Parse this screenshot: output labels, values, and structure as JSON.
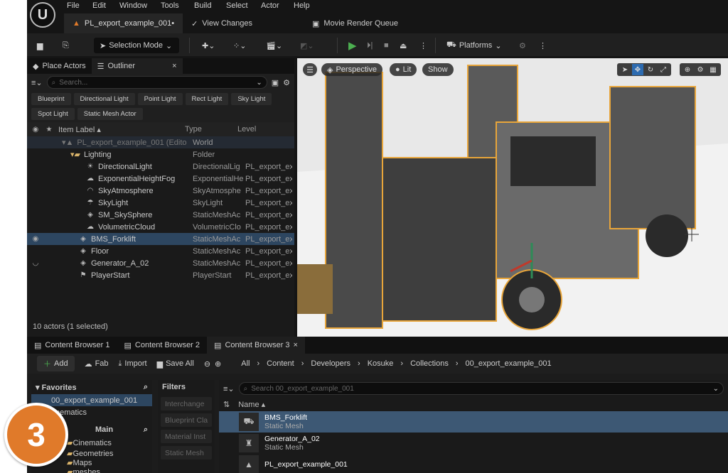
{
  "menu": [
    "File",
    "Edit",
    "Window",
    "Tools",
    "Build",
    "Select",
    "Actor",
    "Help"
  ],
  "tabs": {
    "doc": "PL_export_example_001•",
    "view_changes": "View Changes",
    "movie_render": "Movie Render Queue"
  },
  "toolbar": {
    "selection_mode": "Selection Mode",
    "platforms": "Platforms"
  },
  "left_tabs": {
    "place_actors": "Place Actors",
    "outliner": "Outliner"
  },
  "search": {
    "placeholder": "Search..."
  },
  "chips": [
    "Blueprint",
    "Directional Light",
    "Point Light",
    "Rect Light",
    "Sky Light",
    "Spot Light",
    "Static Mesh Actor"
  ],
  "columns": {
    "label": "Item Label ▴",
    "type": "Type",
    "level": "Level"
  },
  "world_row": {
    "label": "PL_export_example_001 (Edito",
    "type": "World"
  },
  "folder_row": {
    "label": "Lighting",
    "type": "Folder"
  },
  "rows": [
    {
      "label": "DirectionalLight",
      "type": "DirectionalLig",
      "level": "PL_export_exa",
      "icon": "directional-light-icon"
    },
    {
      "label": "ExponentialHeightFog",
      "type": "ExponentialHe",
      "level": "PL_export_exa",
      "icon": "fog-icon"
    },
    {
      "label": "SkyAtmosphere",
      "type": "SkyAtmosphe",
      "level": "PL_export_exa",
      "icon": "sky-atmosphere-icon"
    },
    {
      "label": "SkyLight",
      "type": "SkyLight",
      "level": "PL_export_exa",
      "icon": "skylight-icon"
    },
    {
      "label": "SM_SkySphere",
      "type": "StaticMeshAc",
      "level": "PL_export_exa",
      "icon": "static-mesh-icon"
    },
    {
      "label": "VolumetricCloud",
      "type": "VolumetricClo",
      "level": "PL_export_exa",
      "icon": "cloud-icon"
    },
    {
      "label": "BMS_Forklift",
      "type": "StaticMeshAc",
      "level": "PL_export_exa",
      "icon": "static-mesh-icon"
    },
    {
      "label": "Floor",
      "type": "StaticMeshAc",
      "level": "PL_export_exa",
      "icon": "static-mesh-icon"
    },
    {
      "label": "Generator_A_02",
      "type": "StaticMeshAc",
      "level": "PL_export_exa",
      "icon": "static-mesh-icon"
    },
    {
      "label": "PlayerStart",
      "type": "PlayerStart",
      "level": "PL_export_exa",
      "icon": "player-start-icon"
    }
  ],
  "status": "10 actors (1 selected)",
  "viewport": {
    "perspective": "Perspective",
    "lit": "Lit",
    "show": "Show"
  },
  "cb_tabs": [
    "Content Browser 1",
    "Content Browser 2",
    "Content Browser 3"
  ],
  "cb_toolbar": {
    "add": "Add",
    "fab": "Fab",
    "import": "Import",
    "save_all": "Save All"
  },
  "breadcrumb": [
    "All",
    "Content",
    "Developers",
    "Kosuke",
    "Collections",
    "00_export_example_001"
  ],
  "favorites": {
    "title": "Favorites",
    "item": "00_export_example_001",
    "item2": "nematics"
  },
  "main_tree": {
    "title": "Main",
    "items": [
      "Cinematics",
      "Geometries",
      "Maps",
      "meshes"
    ]
  },
  "filters": {
    "title": "Filters",
    "items": [
      "Interchange",
      "Blueprint Cla",
      "Material Inst",
      "Static Mesh"
    ]
  },
  "asset_search": {
    "placeholder": "Search 00_export_example_001"
  },
  "asset_header": "Name ▴",
  "assets": [
    {
      "name": "BMS_Forklift",
      "type": "Static Mesh"
    },
    {
      "name": "Generator_A_02",
      "type": "Static Mesh"
    },
    {
      "name": "PL_export_example_001",
      "type": ""
    }
  ],
  "step_badge": "3",
  "colors": {
    "accent": "#e07a2a",
    "selection": "#2d4660",
    "play": "#4caf50"
  }
}
